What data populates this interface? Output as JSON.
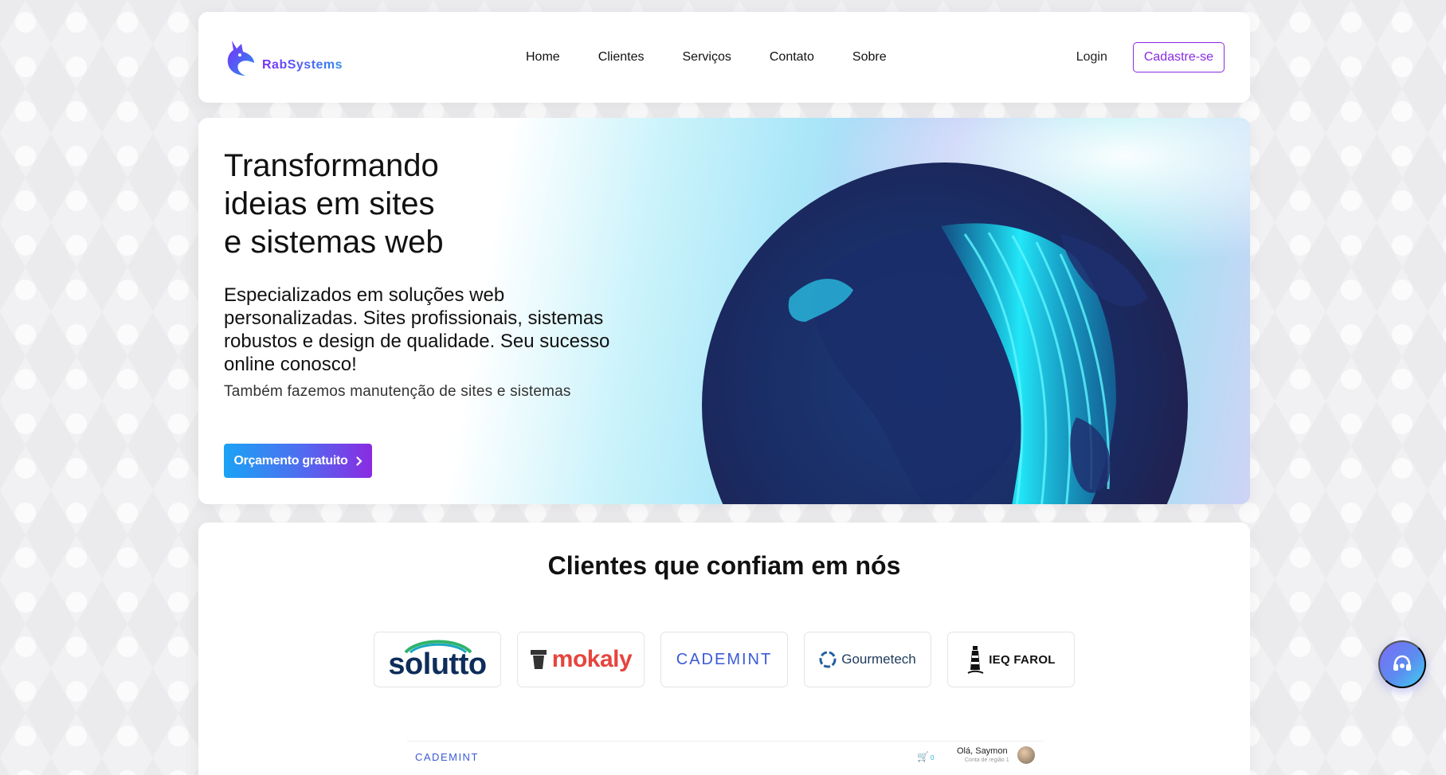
{
  "brand": {
    "name": "RabSystems"
  },
  "nav": {
    "items": [
      {
        "label": "Home"
      },
      {
        "label": "Clientes"
      },
      {
        "label": "Serviços"
      },
      {
        "label": "Contato"
      },
      {
        "label": "Sobre"
      }
    ],
    "login_label": "Login",
    "signup_label": "Cadastre-se"
  },
  "hero": {
    "title_line1": "Transformando",
    "title_line2": "ideias em sites",
    "title_line3": "e sistemas web",
    "subtitle": "Especializados em soluções web personalizadas. Sites profissionais, sistemas robustos e design de qualidade. Seu sucesso online conosco!",
    "note": "Também fazemos manutenção de sites e sistemas",
    "cta_label": "Orçamento gratuito",
    "cta_icon": "chevron-right-icon"
  },
  "clients": {
    "title": "Clientes que confiam em nós",
    "logos": [
      {
        "name": "solutto"
      },
      {
        "name": "mokaly"
      },
      {
        "name": "CADEMINT"
      },
      {
        "name": "Gourmetech"
      },
      {
        "name": "IEQ FAROL"
      }
    ]
  },
  "preview": {
    "brand": "CADEMINT",
    "cart_count": "0",
    "greeting": "Olá, Saymon",
    "greeting_sub": "Conta de região 1"
  },
  "colors": {
    "accent_purple": "#8a2be2",
    "accent_blue": "#1aa3f5",
    "text": "#111111"
  },
  "support": {
    "icon": "headset-icon"
  }
}
